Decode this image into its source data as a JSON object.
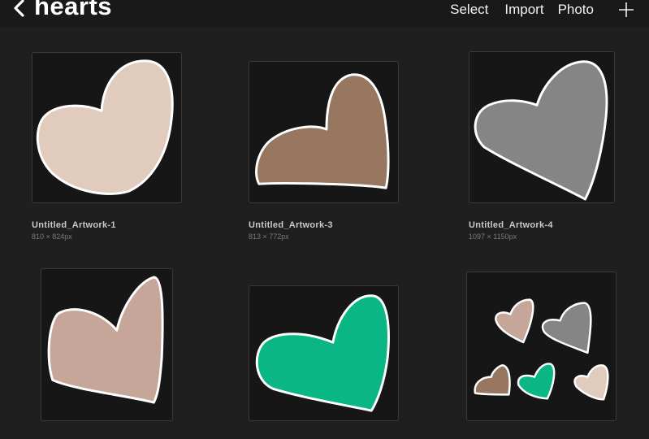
{
  "header": {
    "title": "hearts",
    "select_label": "Select",
    "import_label": "Import",
    "photo_label": "Photo"
  },
  "artworks": [
    {
      "name": "Untitled_Artwork-1",
      "dims": "810 × 824px",
      "fill": "#e0cbbc"
    },
    {
      "name": "Untitled_Artwork-3",
      "dims": "813 × 772px",
      "fill": "#977760"
    },
    {
      "name": "Untitled_Artwork-4",
      "dims": "1097 × 1150px",
      "fill": "#858585"
    },
    {
      "name": "",
      "dims": "",
      "fill": "#c6a699"
    },
    {
      "name": "",
      "dims": "",
      "fill": "#0ab784"
    },
    {
      "name": "",
      "dims": "",
      "fills": [
        "#c6a699",
        "#858585",
        "#977760",
        "#0ab784",
        "#e0cbbc"
      ]
    }
  ],
  "colors": {
    "background": "#1f1f1f",
    "header_background": "#191919",
    "stroke": "#ffffff"
  }
}
